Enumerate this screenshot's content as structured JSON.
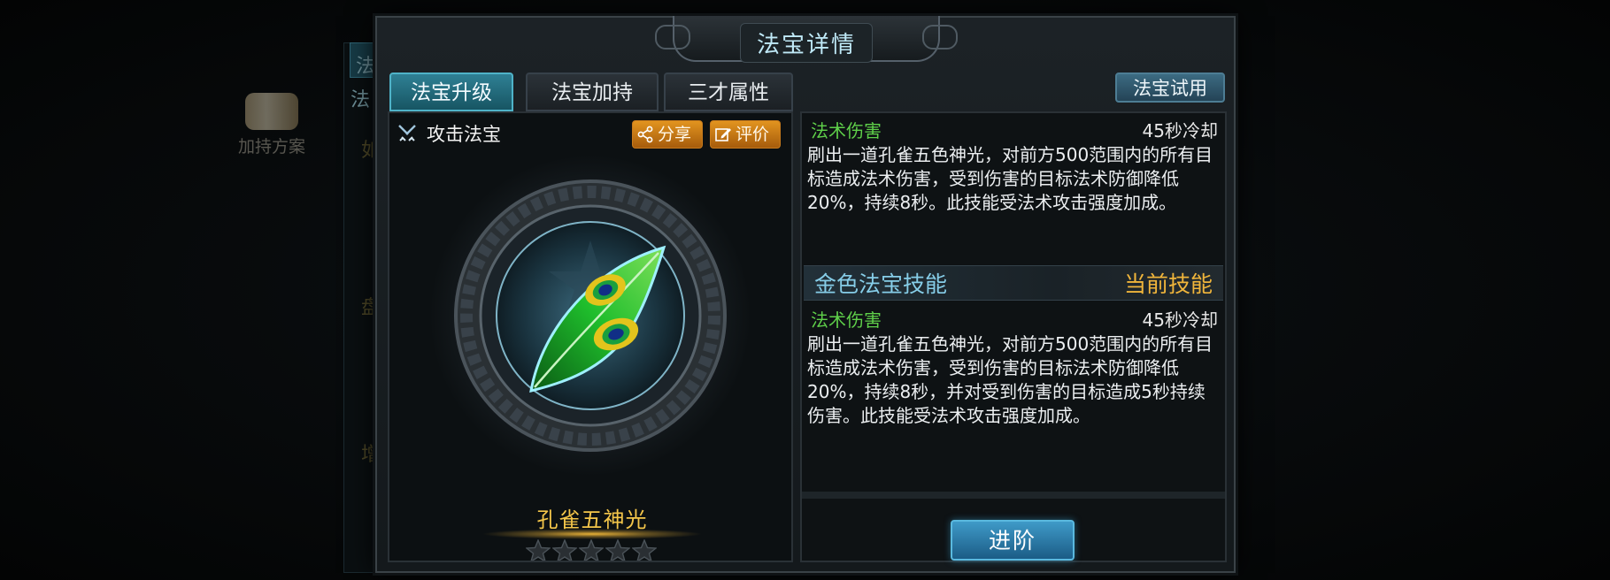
{
  "background": {
    "tab_partial_1": "法",
    "tab_partial_2": "法",
    "side_chars": [
      "如",
      "盘",
      "增"
    ],
    "scheme_label": "加持方案"
  },
  "dialog": {
    "title": "法宝详情",
    "tabs": [
      {
        "label": "法宝升级",
        "active": true
      },
      {
        "label": "法宝加持",
        "active": false
      },
      {
        "label": "三才属性",
        "active": false
      }
    ],
    "trial_button": "法宝试用"
  },
  "left": {
    "type_label": "攻击法宝",
    "share_label": "分享",
    "rate_label": "评价",
    "item_name": "孔雀五神光",
    "stars_filled": 0,
    "stars_total": 5
  },
  "right": {
    "skill_1": {
      "type": "法术伤害",
      "cooldown": "45秒冷却",
      "description": "刷出一道孔雀五色神光，对前方500范围内的所有目标造成法术伤害，受到伤害的目标法术防御降低20%，持续8秒。此技能受法术攻击强度加成。"
    },
    "gold_section_title": "金色法宝技能",
    "current_label": "当前技能",
    "skill_2": {
      "type": "法术伤害",
      "cooldown": "45秒冷却",
      "description": "刷出一道孔雀五色神光，对前方500范围内的所有目标造成法术伤害，受到伤害的目标法术防御降低20%，持续8秒，并对受到伤害的目标造成5秒持续伤害。此技能受法术攻击强度加成。"
    },
    "advance_button": "进阶"
  },
  "colors": {
    "accent_teal": "#2f8094",
    "skill_type_green": "#5fd04a",
    "gold": "#f4c64a",
    "current_label_orange": "#f0b53b",
    "section_blue": "#86cde8",
    "orange_button": "#e2941f"
  }
}
